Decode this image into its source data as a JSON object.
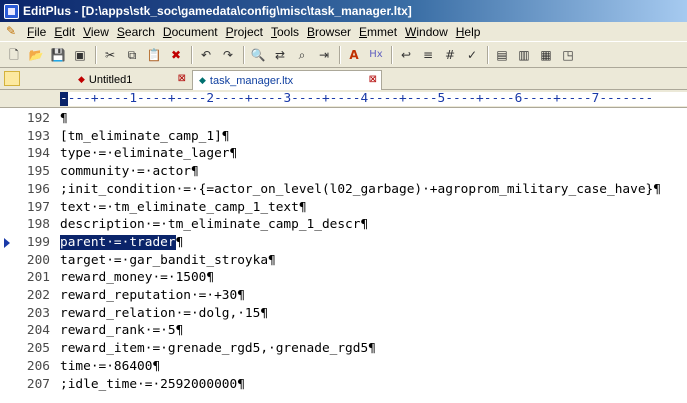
{
  "window": {
    "title": "EditPlus - [D:\\apps\\stk_soc\\gamedata\\config\\misc\\task_manager.ltx]"
  },
  "menu": [
    {
      "label": "File",
      "u": "F",
      "rest": "ile"
    },
    {
      "label": "Edit",
      "u": "E",
      "rest": "dit"
    },
    {
      "label": "View",
      "u": "V",
      "rest": "iew"
    },
    {
      "label": "Search",
      "u": "S",
      "rest": "earch"
    },
    {
      "label": "Document",
      "u": "D",
      "rest": "ocument"
    },
    {
      "label": "Project",
      "u": "P",
      "rest": "roject"
    },
    {
      "label": "Tools",
      "u": "T",
      "rest": "ools"
    },
    {
      "label": "Browser",
      "u": "B",
      "rest": "rowser"
    },
    {
      "label": "Emmet",
      "u": "E",
      "rest": "mmet"
    },
    {
      "label": "Window",
      "u": "W",
      "rest": "indow"
    },
    {
      "label": "Help",
      "u": "H",
      "rest": "elp"
    }
  ],
  "toolbar": [
    "new-file-icon",
    "open-icon",
    "save-icon",
    "save-all-icon",
    "|",
    "cut-icon",
    "copy-icon",
    "paste-icon",
    "delete-icon",
    "|",
    "undo-icon",
    "redo-icon",
    "|",
    "find-icon",
    "replace-icon",
    "find-files-icon",
    "goto-icon",
    "|",
    "font-icon",
    "hex-icon",
    "|",
    "word-wrap-icon",
    "ruler-icon",
    "line-number-icon",
    "spell-check-icon",
    "|",
    "output-window-icon",
    "cliptext-icon",
    "directory-window-icon",
    "browser-icon"
  ],
  "tabs": [
    {
      "label": "Untitled1",
      "active": false
    },
    {
      "label": "task_manager.ltx",
      "active": true
    }
  ],
  "ruler": {
    "cursor": "-",
    "text": "---+----1----+----2----+----3----+----4----+----5----+----6----+----7-------"
  },
  "editor": {
    "lines": [
      {
        "num": "192",
        "text": "¶"
      },
      {
        "num": "193",
        "text": "[tm_eliminate_camp_1]¶"
      },
      {
        "num": "194",
        "text": "type·=·eliminate_lager¶"
      },
      {
        "num": "195",
        "text": "community·=·actor¶"
      },
      {
        "num": "196",
        "text": ";init_condition·=·{=actor_on_level(l02_garbage)·+agroprom_military_case_have}¶"
      },
      {
        "num": "197",
        "text": "text·=·tm_eliminate_camp_1_text¶"
      },
      {
        "num": "198",
        "text": "description·=·tm_eliminate_camp_1_descr¶"
      },
      {
        "num": "199",
        "text": "¶",
        "selected": "parent·=·trader",
        "marker": true
      },
      {
        "num": "200",
        "text": "target·=·gar_bandit_stroyka¶"
      },
      {
        "num": "201",
        "text": "reward_money·=·1500¶"
      },
      {
        "num": "202",
        "text": "reward_reputation·=·+30¶"
      },
      {
        "num": "203",
        "text": "reward_relation·=·dolg,·15¶"
      },
      {
        "num": "204",
        "text": "reward_rank·=·5¶"
      },
      {
        "num": "205",
        "text": "reward_item·=·grenade_rgd5,·grenade_rgd5¶"
      },
      {
        "num": "206",
        "text": "time·=·86400¶"
      },
      {
        "num": "207",
        "text": ";idle_time·=·2592000000¶"
      }
    ]
  }
}
